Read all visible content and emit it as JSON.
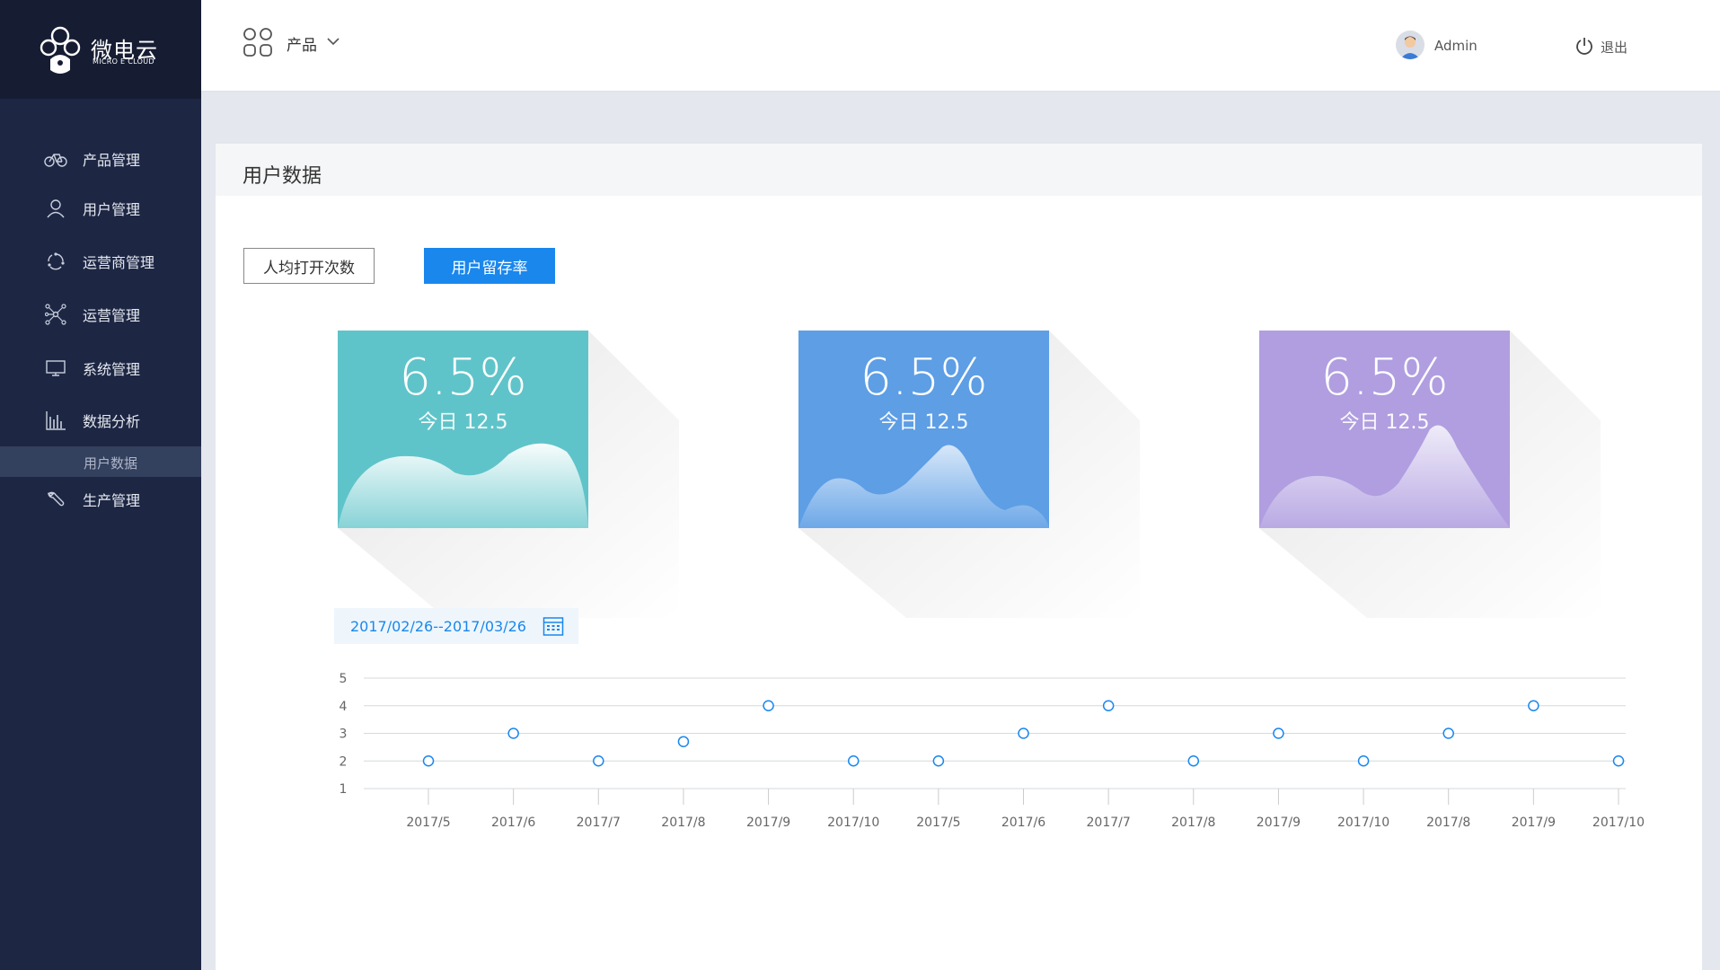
{
  "brand": {
    "name": "微电云",
    "tagline": "MICRO E CLOUD"
  },
  "header": {
    "product_label": "产品",
    "user_name": "Admin",
    "logout_label": "退出"
  },
  "sidebar": {
    "items": [
      {
        "label": "产品管理",
        "icon": "bicycle-icon"
      },
      {
        "label": "用户管理",
        "icon": "user-icon"
      },
      {
        "label": "运营商管理",
        "icon": "refresh-cycle-icon"
      },
      {
        "label": "运营管理",
        "icon": "network-icon"
      },
      {
        "label": "系统管理",
        "icon": "monitor-icon"
      },
      {
        "label": "数据分析",
        "icon": "bar-chart-icon"
      },
      {
        "label": "生产管理",
        "icon": "wrench-icon"
      }
    ],
    "active_sub": "用户数据"
  },
  "page": {
    "title": "用户数据",
    "tabs": [
      {
        "label": "人均打开次数",
        "active": false
      },
      {
        "label": "用户留存率",
        "active": true
      }
    ],
    "cards": [
      {
        "value": "6.5%",
        "sub": "今日 12.5",
        "color": "#5fc4c9"
      },
      {
        "value": "6.5%",
        "sub": "今日 12.5",
        "color": "#5d9ee5"
      },
      {
        "value": "6.5%",
        "sub": "今日 12.5",
        "color": "#b09ee0"
      }
    ],
    "date_range": "2017/02/26--2017/03/26"
  },
  "chart_data": {
    "type": "scatter",
    "categories": [
      "2017/5",
      "2017/6",
      "2017/7",
      "2017/8",
      "2017/9",
      "2017/10",
      "2017/5",
      "2017/6",
      "2017/7",
      "2017/8",
      "2017/9",
      "2017/10",
      "2017/8",
      "2017/9",
      "2017/10"
    ],
    "values": [
      2,
      3,
      2,
      2.7,
      4,
      2,
      2,
      3,
      4,
      2,
      3,
      2,
      3,
      4,
      2
    ],
    "yticks": [
      1,
      2,
      3,
      4,
      5
    ],
    "ylim": [
      1,
      5
    ],
    "grid": true,
    "point_color": "#1a87ed"
  }
}
